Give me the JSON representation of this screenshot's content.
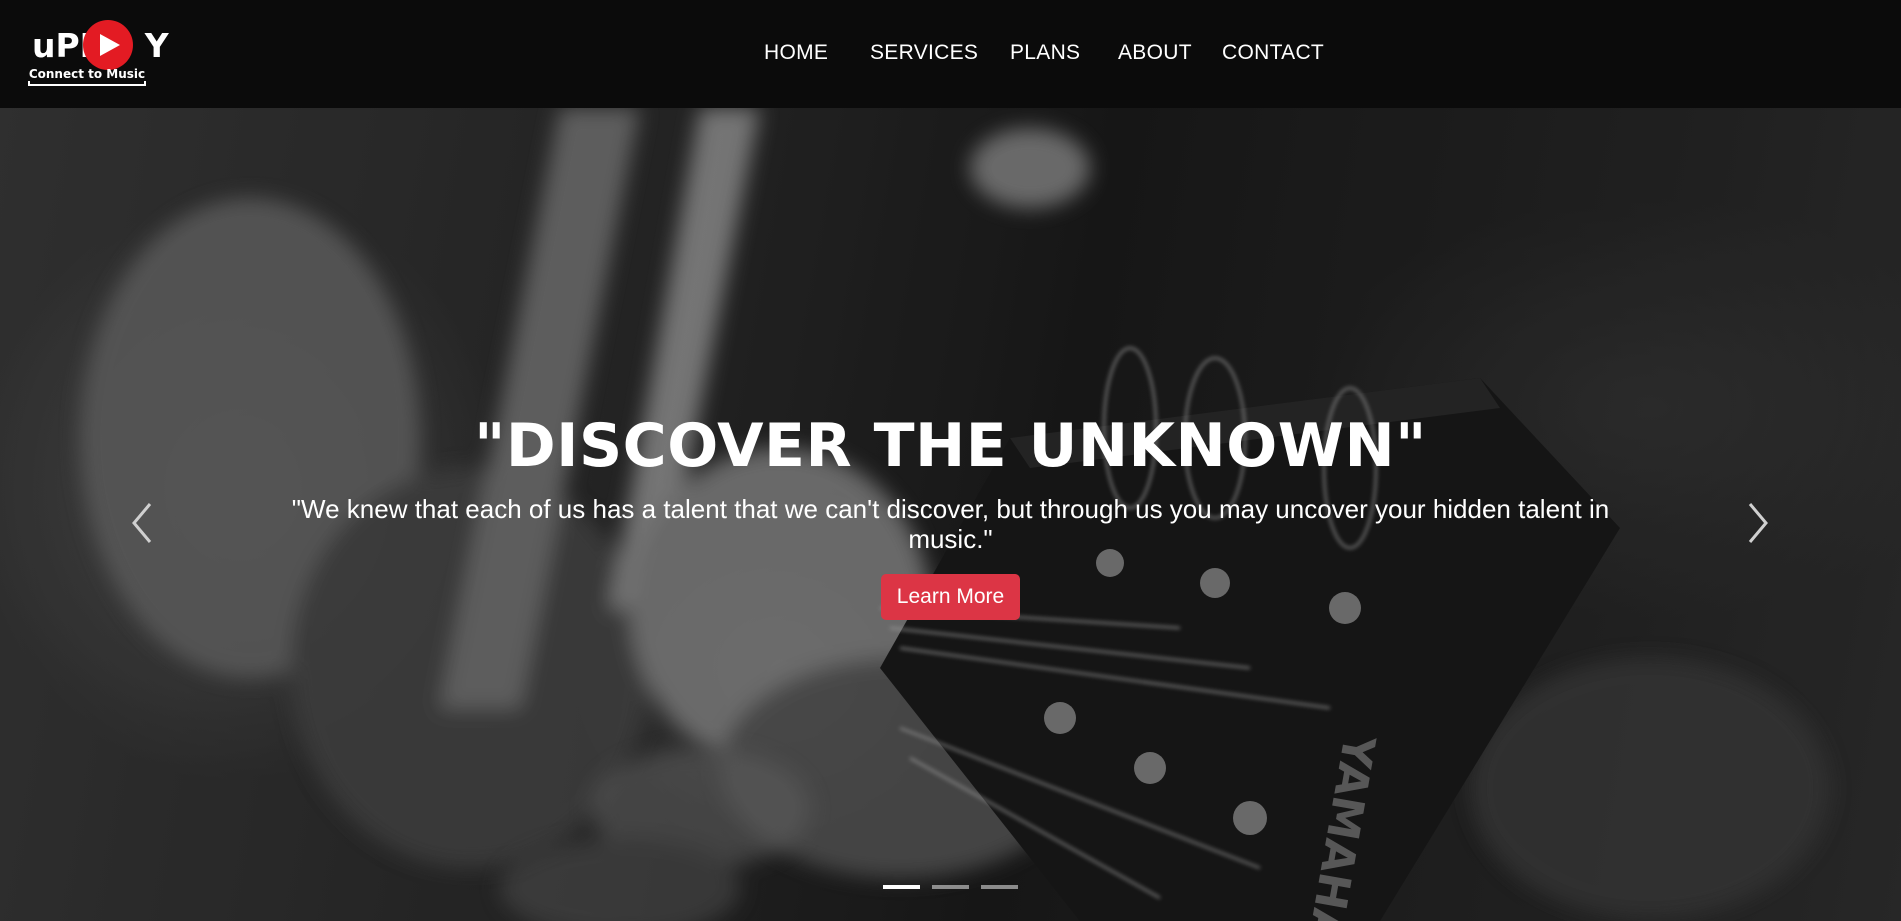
{
  "brand": {
    "logo_text": "uPL",
    "logo_text_end": "Y",
    "tagline": "Connect to Music",
    "accent_color": "#e31b23"
  },
  "nav": {
    "items": [
      {
        "label": "HOME"
      },
      {
        "label": "SERVICES"
      },
      {
        "label": "PLANS"
      },
      {
        "label": "ABOUT"
      },
      {
        "label": "CONTACT"
      }
    ]
  },
  "hero": {
    "title": "\"DISCOVER THE UNKNOWN\"",
    "subtitle": "\"We knew that each of us has a talent that we can't discover, but through us you may uncover your hidden talent in music.\"",
    "button_label": "Learn More",
    "button_color": "#dc3545",
    "prev_icon": "chevron-left-icon",
    "next_icon": "chevron-right-icon",
    "slides_count": 3,
    "active_slide": 1
  }
}
